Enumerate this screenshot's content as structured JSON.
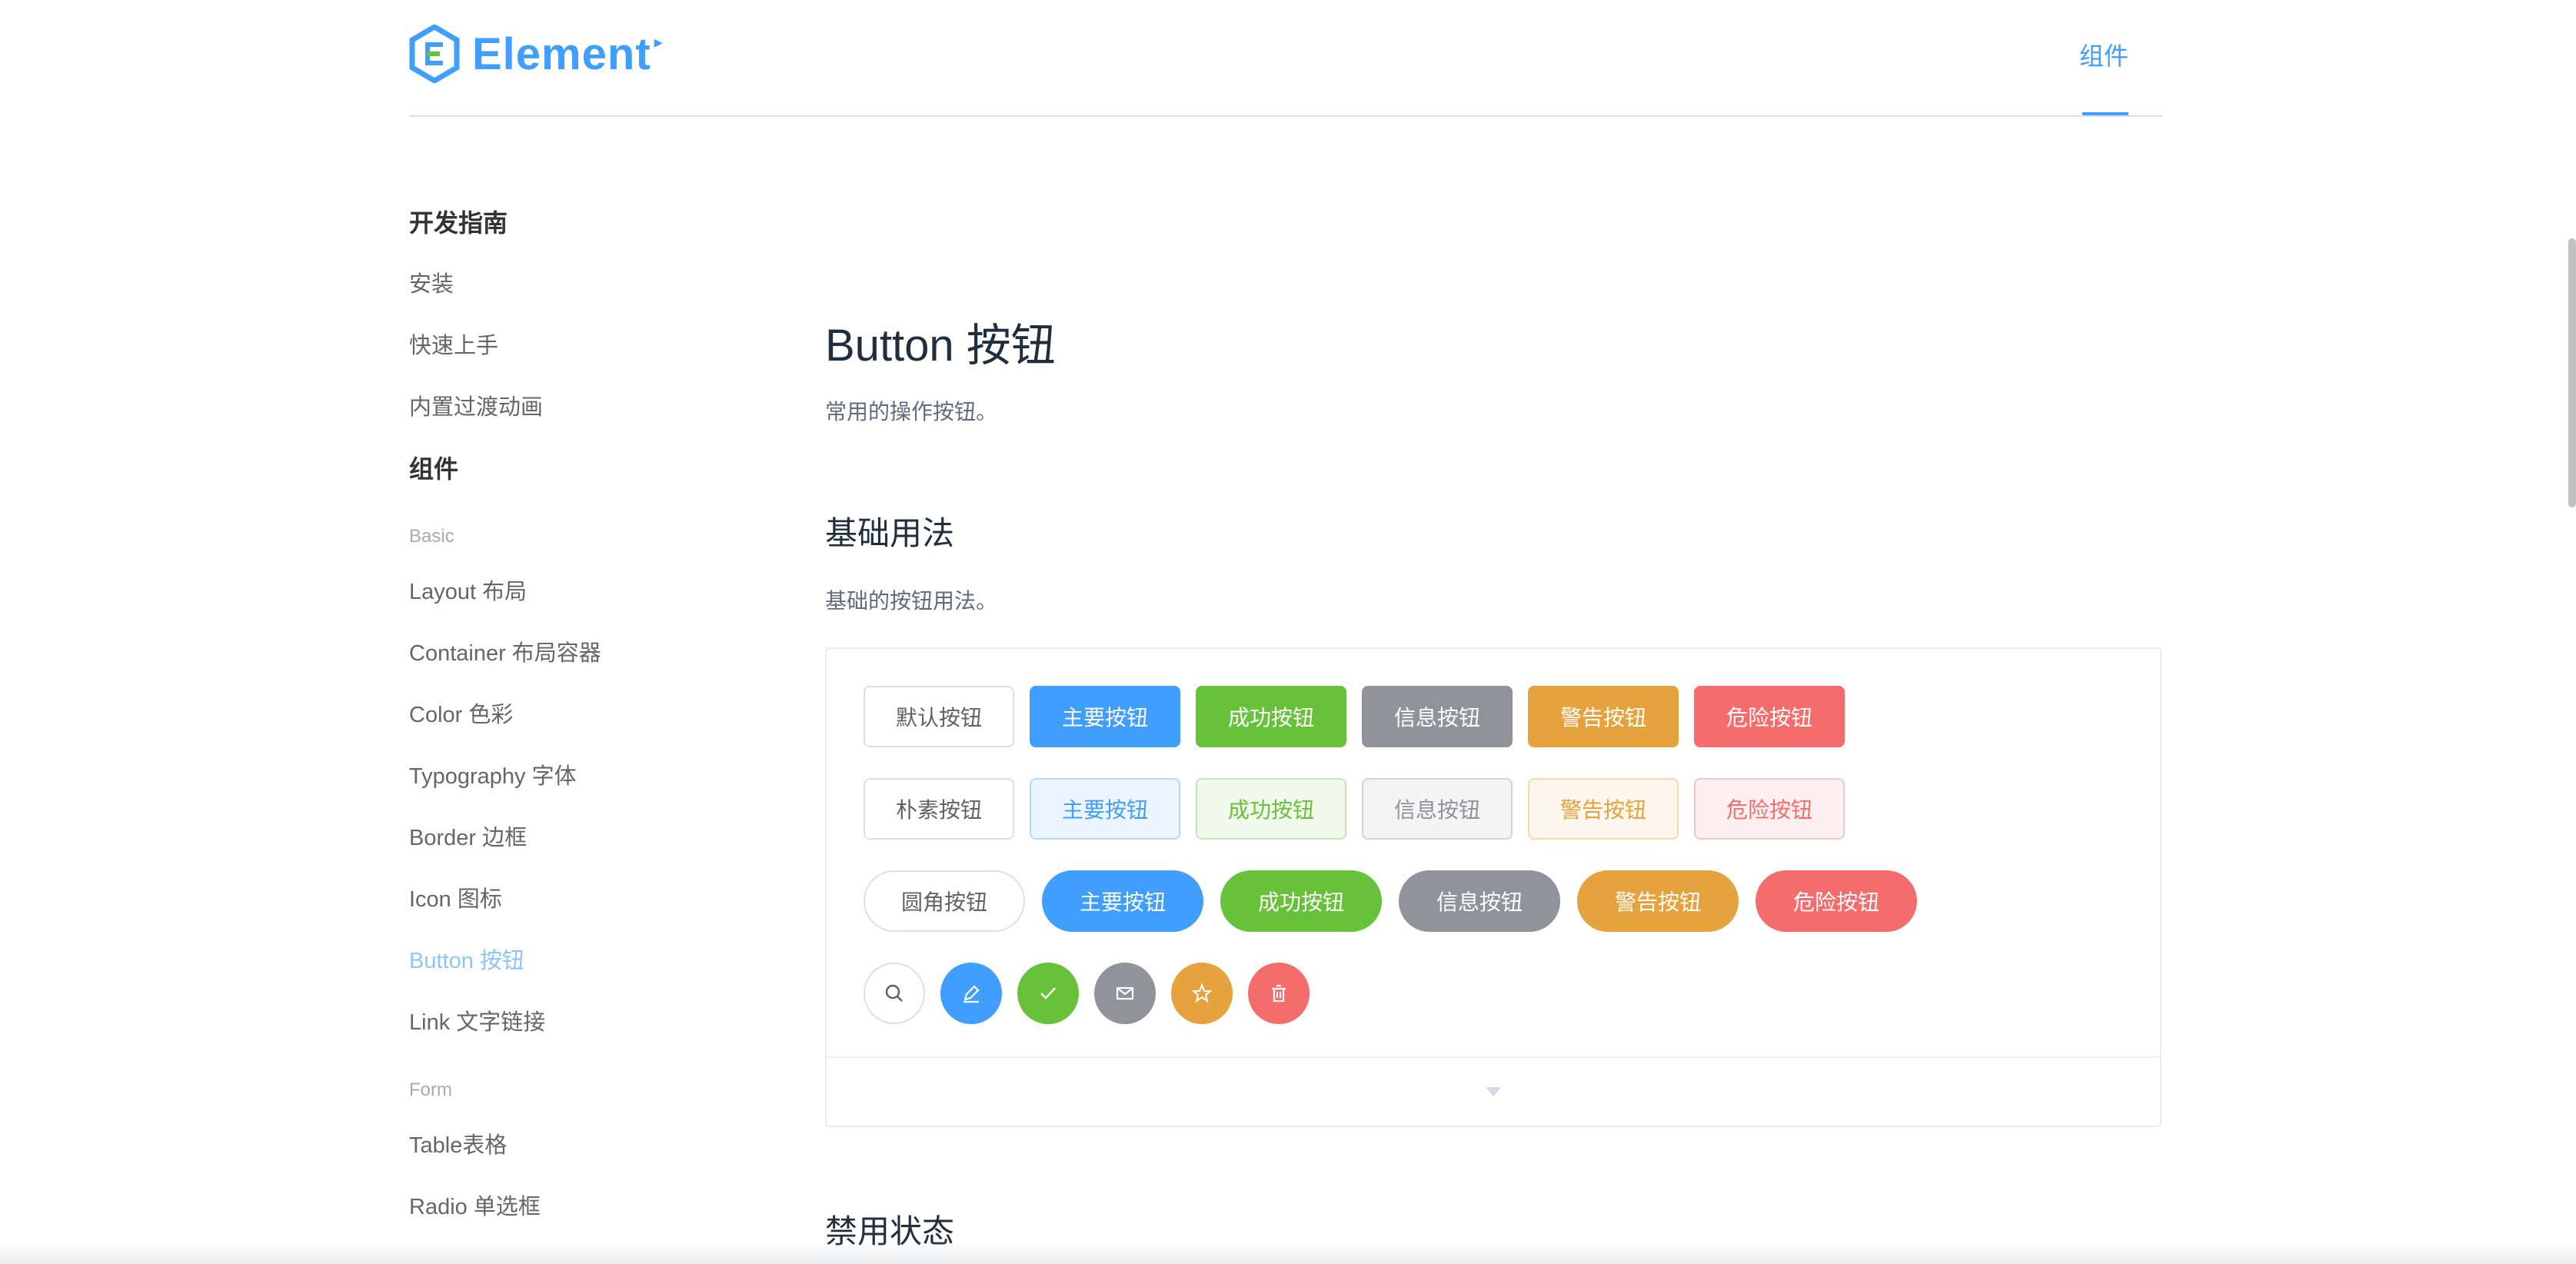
{
  "header": {
    "logo_text": "Element",
    "nav_label": "组件"
  },
  "sidebar": {
    "groups": [
      {
        "title": "开发指南"
      },
      {
        "title": "组件"
      }
    ],
    "guide_links": [
      "安装",
      "快速上手",
      "内置过渡动画"
    ],
    "categories": [
      "Basic",
      "Form"
    ],
    "basic_links": [
      "Layout 布局",
      "Container 布局容器",
      "Color 色彩",
      "Typography 字体",
      "Border 边框",
      "Icon 图标",
      "Button 按钮",
      "Link 文字链接"
    ],
    "form_links": [
      "Table表格",
      "Radio 单选框"
    ],
    "active": "Button 按钮"
  },
  "main": {
    "title": "Button 按钮",
    "description": "常用的操作按钮。",
    "section1": {
      "title": "基础用法",
      "description": "基础的按钮用法。"
    },
    "section2": {
      "title": "禁用状态"
    }
  },
  "demo": {
    "row1": [
      "默认按钮",
      "主要按钮",
      "成功按钮",
      "信息按钮",
      "警告按钮",
      "危险按钮"
    ],
    "row2": [
      "朴素按钮",
      "主要按钮",
      "成功按钮",
      "信息按钮",
      "警告按钮",
      "危险按钮"
    ],
    "row3": [
      "圆角按钮",
      "主要按钮",
      "成功按钮",
      "信息按钮",
      "警告按钮",
      "危险按钮"
    ],
    "row4_icons": [
      "search-icon",
      "edit-icon",
      "check-icon",
      "message-icon",
      "star-icon",
      "delete-icon"
    ]
  },
  "colors": {
    "primary": "#409eff",
    "success": "#67c23a",
    "info": "#909399",
    "warning": "#e6a23c",
    "danger": "#f56c6c"
  }
}
